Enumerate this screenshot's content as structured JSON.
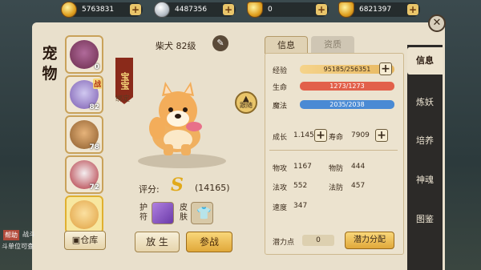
{
  "currencies": [
    {
      "name": "gold-coin",
      "value": "5763831"
    },
    {
      "name": "silver-coin",
      "value": "4487356"
    },
    {
      "name": "gold-ingot-small",
      "value": "0"
    },
    {
      "name": "gold-ingot",
      "value": "6821397"
    }
  ],
  "title": "宠物",
  "pets": [
    {
      "name": "red-demon",
      "level": "0"
    },
    {
      "name": "purple-beast",
      "level": "82",
      "tag": "战"
    },
    {
      "name": "bear-beast",
      "level": "78"
    },
    {
      "name": "white-fox",
      "level": "72"
    },
    {
      "name": "shiba-dog",
      "level": "",
      "selected": true
    }
  ],
  "help": {
    "label": "帮助",
    "text": "战斗",
    "text2": "斗单位可查"
  },
  "store_button": "仓库",
  "pet": {
    "name": "柴犬 82级",
    "tag": "宝宝",
    "bound": "绑定",
    "follow": "跟随",
    "score_label": "评分:",
    "score_grade": "S",
    "score_value": "(14165)",
    "amulet_label": "护符",
    "skin_label": "皮肤"
  },
  "actions": {
    "release": "放 生",
    "battle": "参战"
  },
  "tabs": {
    "info": "信息",
    "aptitude": "资质"
  },
  "stats": {
    "exp_label": "经验",
    "exp_value": "95185/256351",
    "hp_label": "生命",
    "hp_value": "1273/1273",
    "mp_label": "魔法",
    "mp_value": "2035/2038",
    "growth_label": "成长",
    "growth_value": "1.145",
    "life_label": "寿命",
    "life_value": "7909",
    "patk_label": "物攻",
    "patk_value": "1167",
    "pdef_label": "物防",
    "pdef_value": "444",
    "matk_label": "法攻",
    "matk_value": "552",
    "mdef_label": "法防",
    "mdef_value": "457",
    "speed_label": "速度",
    "speed_value": "347",
    "points_label": "潜力点",
    "points_value": "0",
    "alloc_button": "潜力分配"
  },
  "nav": [
    "信息",
    "炼妖",
    "培养",
    "神魂",
    "图鉴"
  ],
  "close": "✕"
}
